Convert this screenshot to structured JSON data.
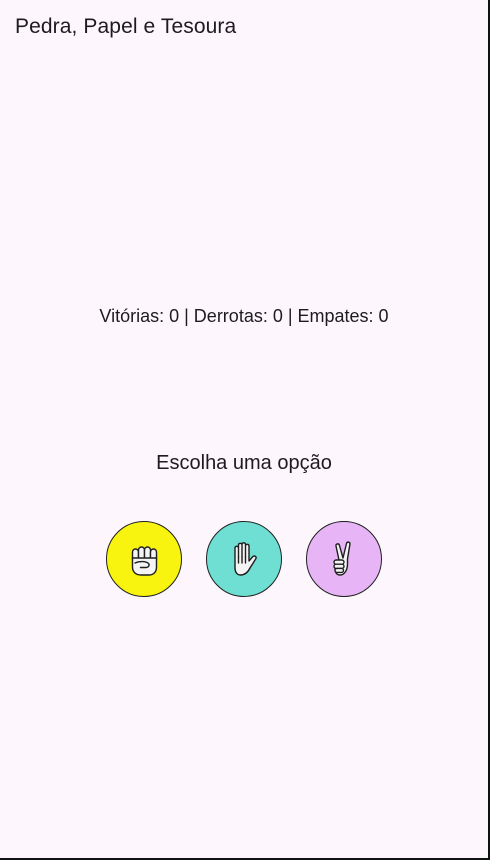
{
  "app_bar": {
    "title": "Pedra, Papel e Tesoura"
  },
  "score": {
    "text": "Vitórias: 0 | Derrotas: 0 | Empates: 0"
  },
  "prompt": {
    "text": "Escolha uma opção"
  },
  "choices": [
    {
      "icon": "rock-fist-icon",
      "color": "#f8f410"
    },
    {
      "icon": "paper-hand-icon",
      "color": "#6fdfd3"
    },
    {
      "icon": "scissors-victory-icon",
      "color": "#e7b5f5"
    }
  ]
}
